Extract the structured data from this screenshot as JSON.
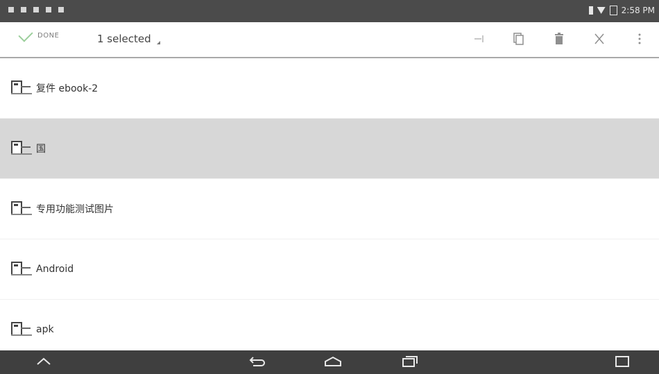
{
  "statusbar": {
    "time": "2:58 PM"
  },
  "actionbar": {
    "done_label": "DONE",
    "selected_label": "1 selected",
    "actions": [
      {
        "icon": "share-icon"
      },
      {
        "icon": "copy-icon"
      },
      {
        "icon": "delete-icon"
      },
      {
        "icon": "cut-icon"
      },
      {
        "icon": "overflow-menu-icon"
      }
    ]
  },
  "items": [
    {
      "label": "复件 ebook-2",
      "selected": false
    },
    {
      "label": "国",
      "selected": true
    },
    {
      "label": "专用功能测试图片",
      "selected": false
    },
    {
      "label": "Android",
      "selected": false
    },
    {
      "label": "apk",
      "selected": false
    }
  ],
  "navbar": {
    "buttons": [
      "collapse-icon",
      "back-icon",
      "home-icon",
      "recents-icon",
      "screenshot-icon"
    ]
  }
}
